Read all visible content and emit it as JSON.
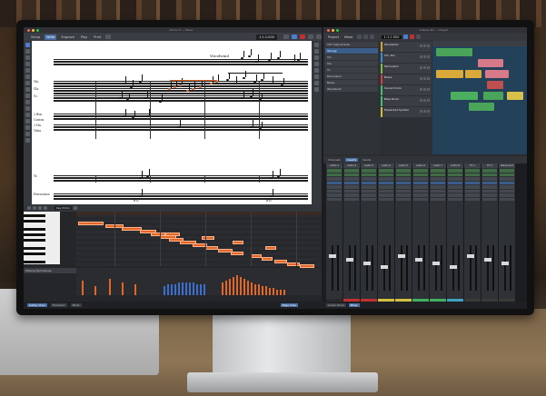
{
  "dorico": {
    "window_title": "Dorico 5 — Music",
    "tabs": [
      "Setup",
      "Write",
      "Engrave",
      "Play",
      "Print"
    ],
    "active_tab": "Write",
    "counter": "1:1:1:000",
    "score": {
      "instrument_labels": [
        "Vln",
        "Vla.",
        "Vc.",
        "2 Bsn.",
        "Contra.",
        "2 Hn.",
        "Tuba",
        "Tr.",
        "Percussion"
      ],
      "woodwind_heading": "Woodwind",
      "annotations": [
        "Tr.",
        "Tbn.",
        "B.D.",
        "B.D."
      ]
    },
    "lower_zone": {
      "select_label": "Key Editor",
      "lane_label": "Playing Techniques"
    },
    "status": {
      "buttons": [
        "Galley View",
        "Transport",
        "Mixer"
      ],
      "right_label": "Page View"
    }
  },
  "cubase": {
    "window_title": "Cubase Pro — Project",
    "tabs": [
      "Project",
      "Mixer"
    ],
    "counter": "1:1:1:000",
    "inspector_rows": [
      "VST Instruments",
      "Strings",
      "Vln",
      "Vla",
      "Vc",
      "Percussion",
      "Brass",
      "Woodwind"
    ],
    "tracks": [
      {
        "name": "Woodwind",
        "color": "#d4a030"
      },
      {
        "name": "Vln. Div.",
        "color": "#3a8dd0"
      },
      {
        "name": "Percussion",
        "color": "#80c040"
      },
      {
        "name": "Brass",
        "color": "#d04040"
      },
      {
        "name": "Sound Drum",
        "color": "#40c070"
      },
      {
        "name": "Bass Drum",
        "color": "#40c070"
      },
      {
        "name": "Expanded Symbol",
        "color": "#d0c040"
      }
    ],
    "parts": [
      {
        "color": "#4aa55a"
      },
      {
        "color": "#d67a8a"
      },
      {
        "color": "#d9a93a"
      },
      {
        "color": "#d9a93a"
      },
      {
        "color": "#d67a8a"
      },
      {
        "color": "#c05050"
      },
      {
        "color": "#4ab060"
      },
      {
        "color": "#4aa55a"
      },
      {
        "color": "#d9c04a"
      },
      {
        "color": "#4aa55a"
      }
    ],
    "mixer_tabs": [
      "Channels",
      "Inserts",
      "Sends"
    ],
    "mixer_active": "Inserts",
    "strips": [
      {
        "name": "Audio 1",
        "color": "#2a2a2a"
      },
      {
        "name": "Audio 2",
        "color": "#c03030"
      },
      {
        "name": "Audio 3",
        "color": "#c03030"
      },
      {
        "name": "Audio 4",
        "color": "#d4c040"
      },
      {
        "name": "Audio 5",
        "color": "#d4c040"
      },
      {
        "name": "Audio 6",
        "color": "#40b060"
      },
      {
        "name": "Audio 7",
        "color": "#40b060"
      },
      {
        "name": "Audio 8",
        "color": "#40a0c0"
      },
      {
        "name": "FX 1",
        "color": "#3a3a3a"
      },
      {
        "name": "FX 2",
        "color": "#3a3a3a"
      },
      {
        "name": "Stereo Out",
        "color": "#3a3a3a"
      }
    ],
    "status_items": [
      "Lower Zone",
      "Mixer"
    ]
  }
}
